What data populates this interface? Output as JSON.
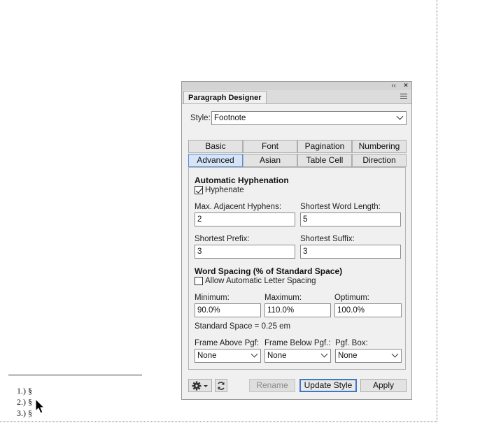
{
  "document": {
    "footnotes": [
      "1.) §",
      "2.) §",
      "3.) §"
    ]
  },
  "panel": {
    "title": "Paragraph Designer",
    "titlebar_buttons": {
      "collapse": "‹‹",
      "close": "×"
    },
    "style_label": "Style:",
    "style_value": "Footnote",
    "tabs_row1": [
      "Basic",
      "Font",
      "Pagination",
      "Numbering"
    ],
    "tabs_row2": [
      "Advanced",
      "Asian",
      "Table Cell",
      "Direction"
    ],
    "active_tab": "Advanced",
    "hyphenation": {
      "heading": "Automatic Hyphenation",
      "hyphenate_label": "Hyphenate",
      "hyphenate_checked": true,
      "max_adjacent_label": "Max. Adjacent Hyphens:",
      "max_adjacent_value": "2",
      "shortest_word_label": "Shortest Word Length:",
      "shortest_word_value": "5",
      "shortest_prefix_label": "Shortest Prefix:",
      "shortest_prefix_value": "3",
      "shortest_suffix_label": "Shortest Suffix:",
      "shortest_suffix_value": "3"
    },
    "word_spacing": {
      "heading": "Word Spacing (% of Standard Space)",
      "allow_letter_spacing_label": "Allow Automatic Letter Spacing",
      "allow_letter_spacing_checked": false,
      "minimum_label": "Minimum:",
      "minimum_value": "90.0%",
      "maximum_label": "Maximum:",
      "maximum_value": "110.0%",
      "optimum_label": "Optimum:",
      "optimum_value": "100.0%",
      "standard_space": "Standard Space = 0.25 em"
    },
    "frames": {
      "above_label": "Frame Above Pgf:",
      "above_value": "None",
      "below_label": "Frame Below Pgf.:",
      "below_value": "None",
      "box_label": "Pgf. Box:",
      "box_value": "None"
    },
    "buttons": {
      "rename": "Rename",
      "update_style": "Update Style",
      "apply": "Apply"
    }
  },
  "colors": {
    "panel_bg": "#f0f0f0",
    "active_tab": "#d5e5f7",
    "default_button_border": "#3b78c8"
  }
}
